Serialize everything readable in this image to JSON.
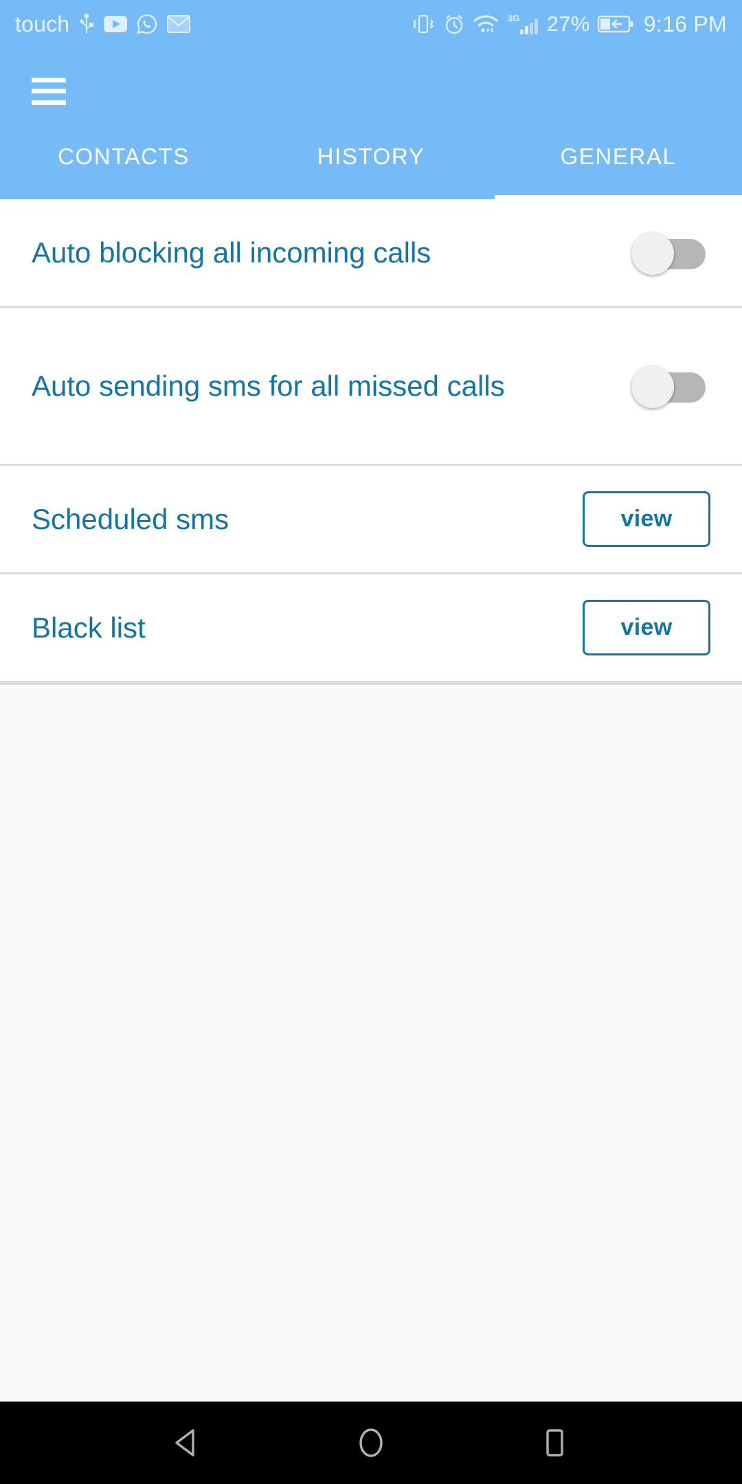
{
  "status_bar": {
    "carrier": "touch",
    "left_icons": [
      "usb-icon",
      "youtube-icon",
      "whatsapp-icon",
      "email-icon"
    ],
    "right_icons": [
      "vibrate-icon",
      "alarm-icon",
      "wifi-icon",
      "signal-3g-icon"
    ],
    "network_type": "3G",
    "battery_percent": "27%",
    "battery_state": "charging",
    "time": "9:16 PM"
  },
  "app_bar": {
    "menu_icon": "hamburger-menu-icon",
    "accent_color": "#74bbf7"
  },
  "tabs": [
    {
      "label": "CONTACTS",
      "active": false
    },
    {
      "label": "HISTORY",
      "active": false
    },
    {
      "label": "GENERAL",
      "active": true
    }
  ],
  "settings": {
    "link_color": "#1275a8",
    "rows": [
      {
        "label": "Auto blocking all incoming calls",
        "control": "switch",
        "value": "off"
      },
      {
        "label": "Auto sending sms for all missed calls",
        "control": "switch",
        "value": "off"
      },
      {
        "label": "Scheduled sms",
        "control": "button",
        "button_label": "view"
      },
      {
        "label": "Black list",
        "control": "button",
        "button_label": "view"
      }
    ]
  },
  "nav_bar": {
    "back": "back-triangle-icon",
    "home": "home-circle-icon",
    "recents": "recents-square-icon"
  }
}
